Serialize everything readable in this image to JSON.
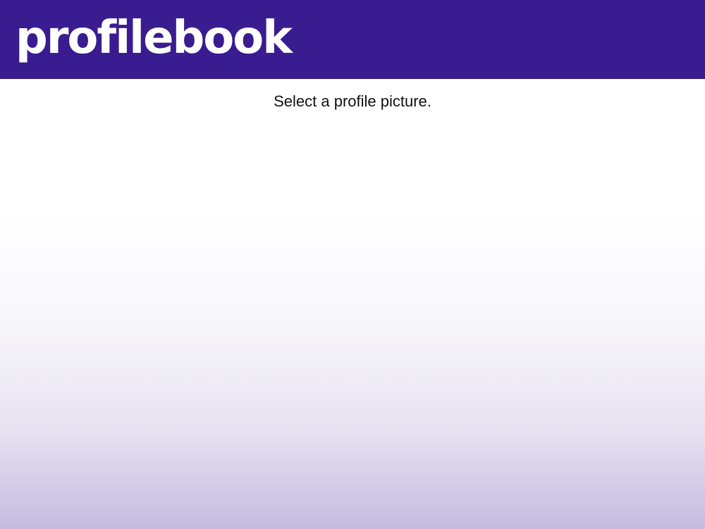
{
  "header": {
    "logo_text": "profilebook",
    "background_color": "#3a1c91"
  },
  "main": {
    "prompt_text": "Select a profile picture."
  },
  "colors": {
    "gradient_bottom": "#c4bcdf",
    "text": "#111111"
  }
}
